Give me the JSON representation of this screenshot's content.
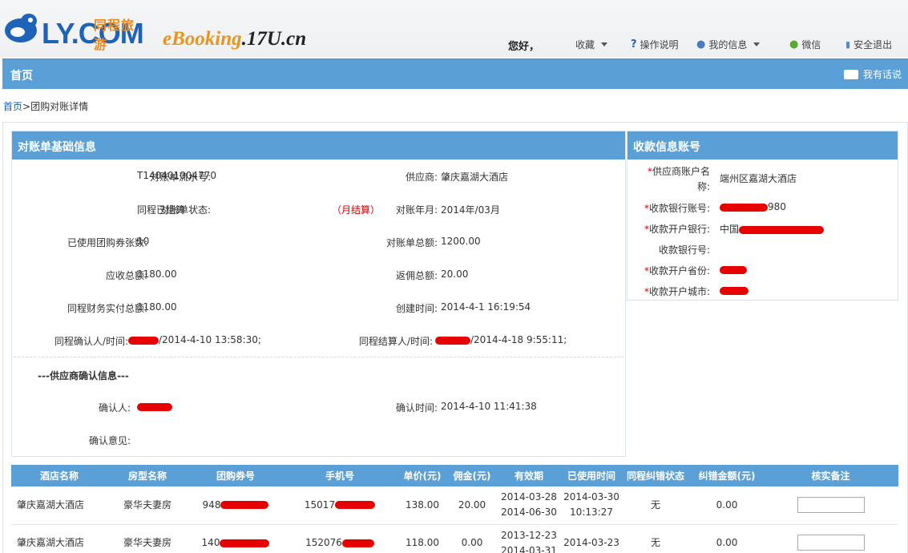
{
  "header": {
    "logo_text": "LY.COM",
    "logo_cn": "同程旅游",
    "ebooking_prefix": "eBooking",
    "ebooking_domain": ".17U.cn",
    "greeting": "您好，",
    "nav": {
      "favorites": "收藏",
      "help": "操作说明",
      "my_info": "我的信息",
      "wechat": "微信",
      "logout": "安全退出"
    }
  },
  "navbar": {
    "home": "首页",
    "feedback": "我有话说"
  },
  "breadcrumb": {
    "home": "首页",
    "separator": ">",
    "current": "团购对账详情"
  },
  "basic_info": {
    "title": "对账单基础信息",
    "rows": {
      "serial_label": "对账单流水号:",
      "serial_value": "T140401004770",
      "supplier_label": "供应商:",
      "supplier_value": "肇庆嘉湖大酒店",
      "status_label": "对账单状态:",
      "status_value": "同程已结算",
      "settle_type": "（月结算）",
      "period_label": "对账年月:",
      "period_value": "2014年/03月",
      "used_label": "已使用团购券张数:",
      "used_value": "10",
      "total_label": "对账单总额:",
      "total_value": "1200.00",
      "receivable_label": "应收总额:",
      "receivable_value": "1180.00",
      "rebate_label": "返佣总额:",
      "rebate_value": "20.00",
      "paid_label": "同程财务实付总额:",
      "paid_value": "1180.00",
      "created_label": "创建时间:",
      "created_value": "2014-4-1 16:19:54",
      "confirm_label": "同程确认人/时间:",
      "confirm_value": "/2014-4-10 13:58:30;",
      "settle_label": "同程结算人/时间:",
      "settle_value": "/2014-4-18 9:55:11;"
    },
    "supplier_section": "---供应商确认信息---",
    "confirmer_label": "确认人:",
    "confirm_time_label": "确认时间:",
    "confirm_time_value": "2014-4-10 11:41:38",
    "opinion_label": "确认意见:"
  },
  "account_info": {
    "title": "收款信息账号",
    "account_name_label_1": "供应商账户名",
    "account_name_label_2": "称:",
    "account_name_value": "端州区嘉湖大酒店",
    "bank_account_label": "收款银行账号:",
    "bank_account_value": "980",
    "bank_label": "收款开户银行:",
    "bank_value": "中国",
    "bank_no_label": "收款银行号:",
    "province_label": "收款开户省份:",
    "city_label": "收款开户城市:",
    "required_mark": "*"
  },
  "table": {
    "headers": [
      "酒店名称",
      "房型名称",
      "团购券号",
      "手机号",
      "单价(元)",
      "佣金(元)",
      "有效期",
      "已使用时间",
      "同程纠错状态",
      "纠错金额(元)",
      "核实备注"
    ],
    "rows": [
      {
        "hotel": "肇庆嘉湖大酒店",
        "room": "豪华夫妻房",
        "coupon": "948",
        "phone": "15017",
        "price": "138.00",
        "commission": "20.00",
        "valid_from": "2014-03-28",
        "valid_to": "2014-06-30",
        "used_date": "2014-03-30",
        "used_time": "10:13:27",
        "status": "无",
        "amount": "0.00"
      },
      {
        "hotel": "肇庆嘉湖大酒店",
        "room": "豪华夫妻房",
        "coupon": "140",
        "phone": "152076",
        "price": "118.00",
        "commission": "0.00",
        "valid_from": "2013-12-23",
        "valid_to": "2014-03-31",
        "used_date": "2014-03-23",
        "used_time": "",
        "status": "无",
        "amount": "0.00"
      }
    ]
  }
}
